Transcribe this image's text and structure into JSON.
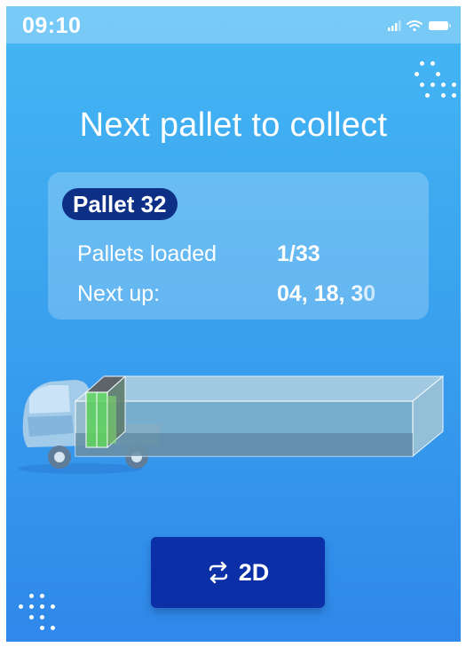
{
  "status_bar": {
    "time": "09:10",
    "icons": [
      "signal-icon",
      "wifi-icon",
      "battery-icon"
    ]
  },
  "screen": {
    "title": "Next pallet to collect"
  },
  "card": {
    "badge": "Pallet 32",
    "loaded_label": "Pallets loaded",
    "loaded_value": "1/33",
    "next_label": "Next up:",
    "next_value": "04, 18, 30"
  },
  "visualization": {
    "loaded_pallets": 1,
    "total_pallets": 33,
    "highlight_color": "#5fd45a",
    "container_color": "#9fc4d8"
  },
  "view_toggle": {
    "icon": "swap-icon",
    "label": "2D"
  },
  "colors": {
    "gradient_top": "#45b7f4",
    "gradient_bottom": "#2f88ea",
    "badge_bg": "#0d2f86",
    "button_bg": "#0a2fa6"
  }
}
